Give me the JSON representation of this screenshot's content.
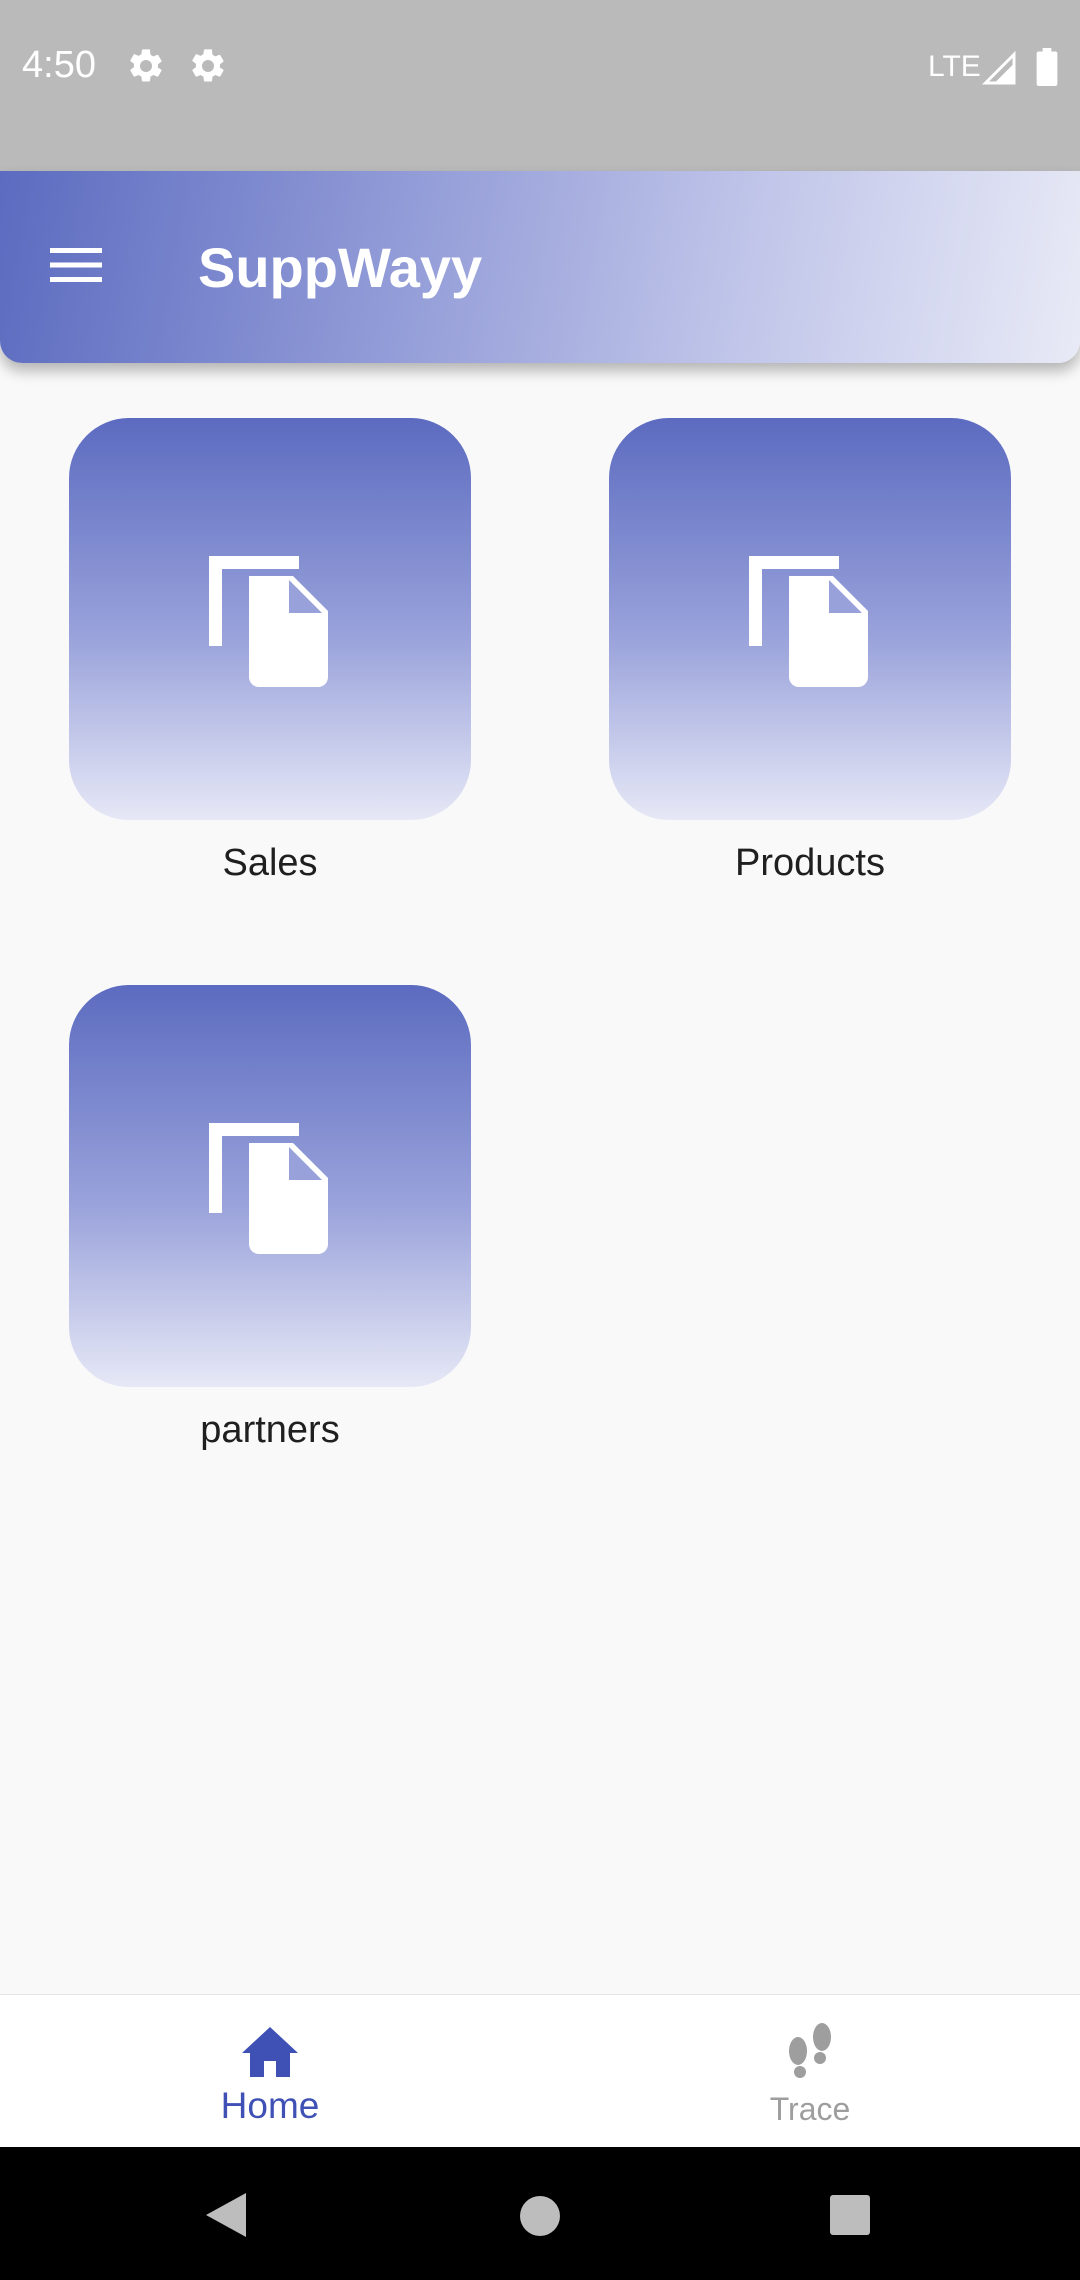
{
  "status_bar": {
    "time": "4:50",
    "network": "LTE",
    "icons": [
      "settings-gear-icon",
      "settings-gear-icon",
      "signal-icon",
      "battery-icon"
    ]
  },
  "app_bar": {
    "title": "SuppWayy",
    "menu_icon": "hamburger-menu-icon"
  },
  "tiles": [
    {
      "label": "Sales",
      "icon": "copy-document-icon"
    },
    {
      "label": "Products",
      "icon": "copy-document-icon"
    },
    {
      "label": "partners",
      "icon": "copy-document-icon"
    }
  ],
  "bottom_nav": {
    "items": [
      {
        "label": "Home",
        "icon": "home-icon",
        "active": true
      },
      {
        "label": "Trace",
        "icon": "footprints-icon",
        "active": false
      }
    ]
  },
  "colors": {
    "accent": "#3f51b5",
    "tile_gradient_top": "#5c6bc0",
    "tile_gradient_bottom": "#e6e8f6",
    "inactive": "#9e9e9e"
  },
  "system_nav": [
    "back-icon",
    "home-circle-icon",
    "recents-icon"
  ]
}
